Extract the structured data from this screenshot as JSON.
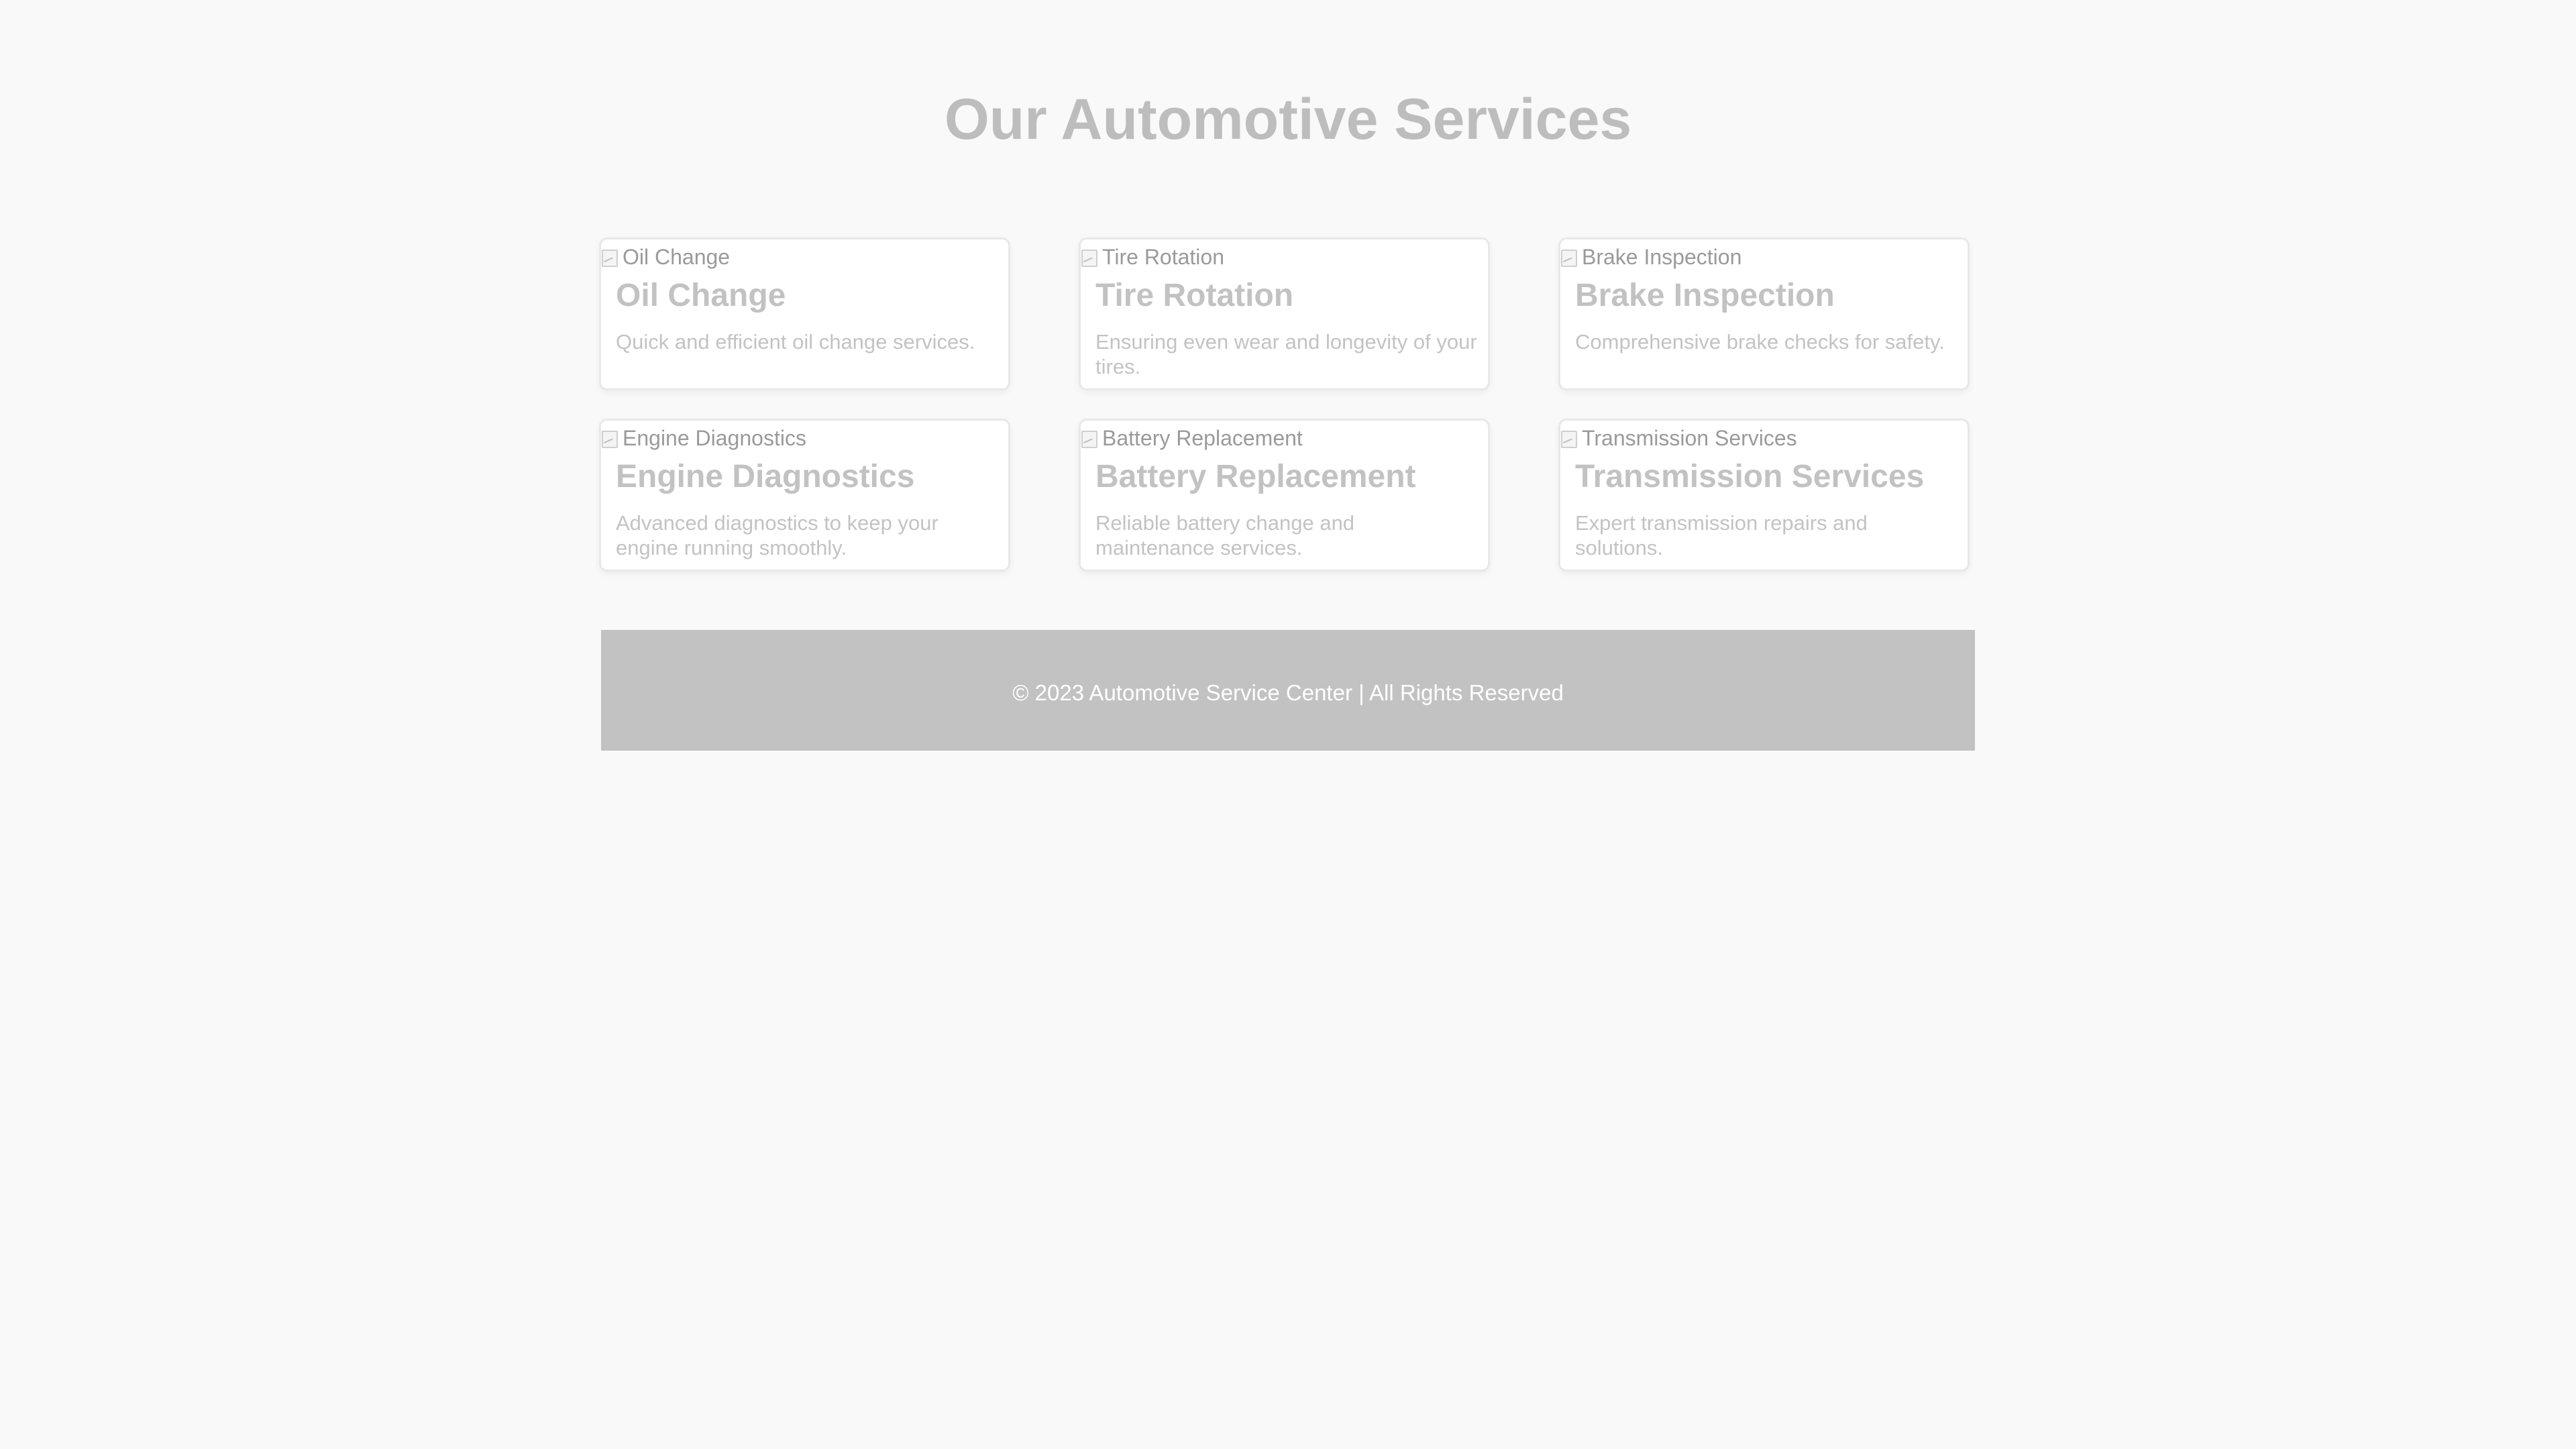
{
  "page": {
    "title": "Our Automotive Services"
  },
  "services": [
    {
      "image_alt": "Oil Change",
      "title": "Oil Change",
      "description": "Quick and efficient oil change services."
    },
    {
      "image_alt": "Tire Rotation",
      "title": "Tire Rotation",
      "description": "Ensuring even wear and longevity of your tires."
    },
    {
      "image_alt": "Brake Inspection",
      "title": "Brake Inspection",
      "description": "Comprehensive brake checks for safety."
    },
    {
      "image_alt": "Engine Diagnostics",
      "title": "Engine Diagnostics",
      "description": "Advanced diagnostics to keep your engine running smoothly."
    },
    {
      "image_alt": "Battery Replacement",
      "title": "Battery Replacement",
      "description": "Reliable battery change and maintenance services."
    },
    {
      "image_alt": "Transmission Services",
      "title": "Transmission Services",
      "description": "Expert transmission repairs and solutions."
    }
  ],
  "footer": {
    "text": "© 2023 Automotive Service Center | All Rights Reserved"
  },
  "icons": {
    "service_image": "broken-image-icon"
  },
  "colors": {
    "background": "#f9f9f9",
    "card_background": "#ffffff",
    "card_border": "#e8e8e8",
    "heading": "#bdbdbd",
    "muted_text": "#c3c3c3",
    "image_alt_text": "#9a9a9a",
    "footer_background": "#c2c2c2",
    "footer_text": "#ffffff"
  }
}
